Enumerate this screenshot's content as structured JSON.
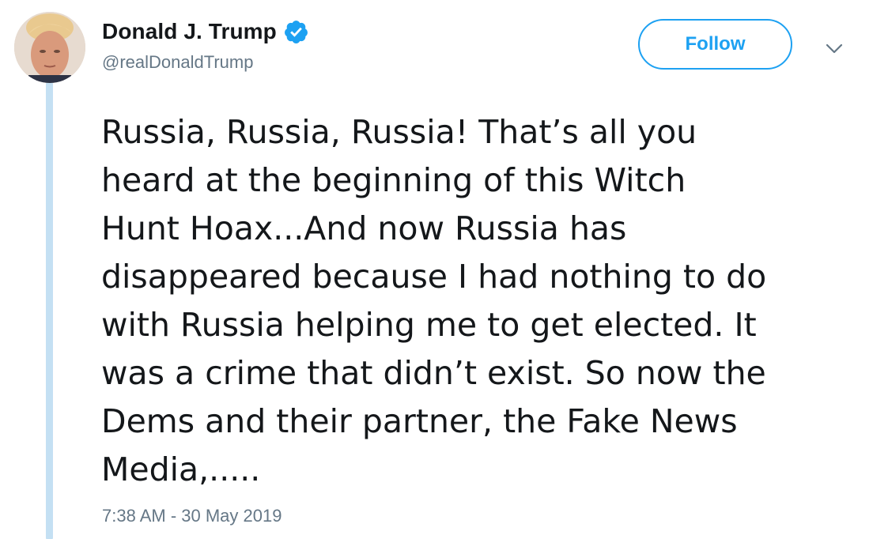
{
  "tweet": {
    "author": {
      "display_name": "Donald J. Trump",
      "handle": "@realDonaldTrump",
      "verified_icon": "verified-badge-icon",
      "avatar_icon": "profile-photo"
    },
    "follow_label": "Follow",
    "menu_icon": "chevron-down-icon",
    "text": "Russia, Russia, Russia! That’s all you\nheard at the beginning of this Witch\nHunt Hoax...And now Russia has\ndisappeared because I had nothing to do\nwith Russia helping me to get elected. It\nwas a crime that didn’t exist. So now the\nDems and their partner, the Fake News\nMedia,.....",
    "timestamp": "7:38 AM - 30 May 2019"
  },
  "colors": {
    "accent": "#1da1f2",
    "secondary_text": "#657786",
    "primary_text": "#14171a",
    "thread_line": "#c4e0f3"
  }
}
